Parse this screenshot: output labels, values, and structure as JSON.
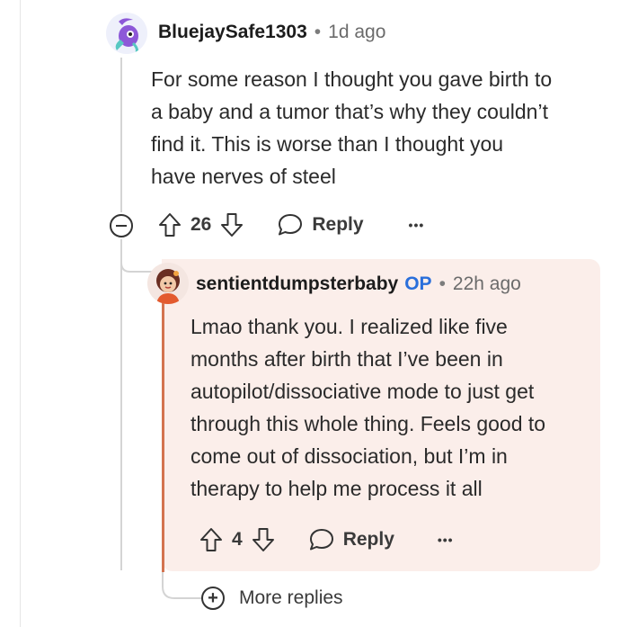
{
  "comment": {
    "username": "BluejaySafe1303",
    "separator": "•",
    "time": "1d ago",
    "lines": [
      "For some reason I thought you gave birth to",
      "a baby and a tumor that’s why they couldn’t",
      "find it. This is worse than I thought you",
      "have nerves of steel"
    ],
    "upvotes": "26",
    "reply_label": "Reply",
    "more_label": "•••"
  },
  "reply": {
    "username": "sentientdumpsterbaby",
    "op_badge": "OP",
    "separator": "•",
    "time": "22h ago",
    "lines": [
      "Lmao thank you. I realized like five",
      "months after birth that I’ve been in",
      "autopilot/dissociative mode to just get",
      "through this whole thing. Feels good to",
      "come out of dissociation, but I’m in",
      "therapy to help me process it all"
    ],
    "upvotes": "4",
    "reply_label": "Reply",
    "more_label": "•••"
  },
  "more_replies": {
    "label": "More replies",
    "icon": "plus-circle-icon"
  },
  "colors": {
    "reply_background": "#fbeeea",
    "op_badge": "#2a6fdb",
    "thread_line": "#d4d4d4",
    "reply_accent": "#d4734f"
  }
}
